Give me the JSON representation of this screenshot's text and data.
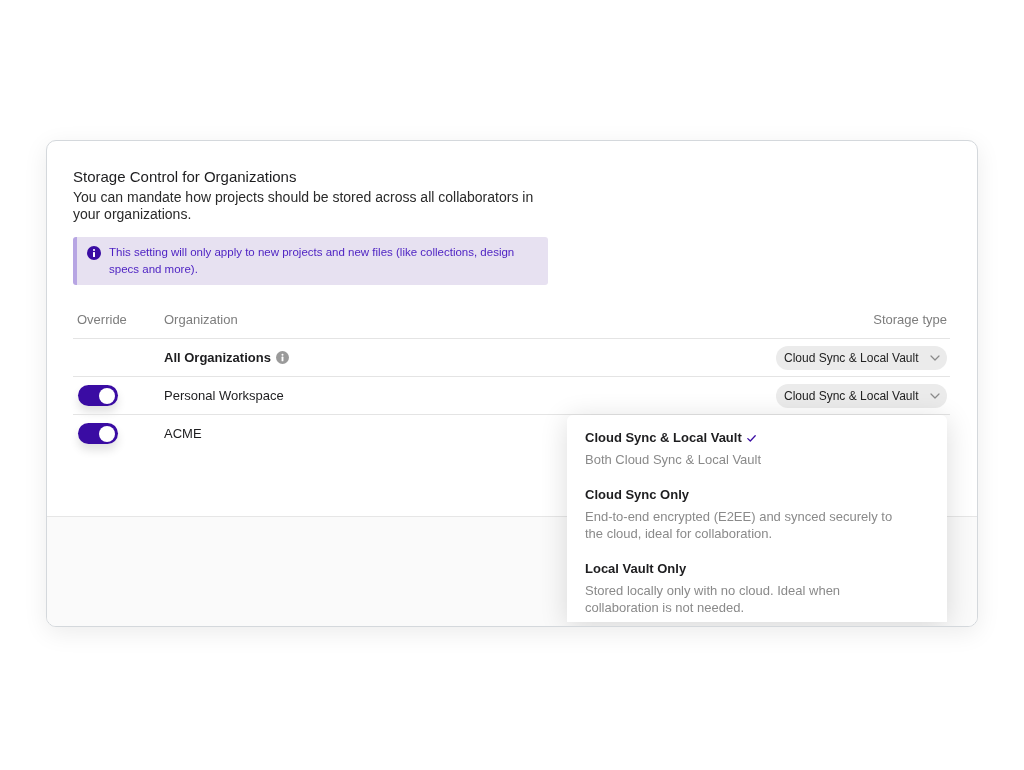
{
  "panel": {
    "title": "Storage Control for Organizations",
    "description": "You can mandate how projects should be stored across all collaborators in your organizations.",
    "notice": "This setting will only apply to new projects and new files (like collections, design specs and more)."
  },
  "table": {
    "columns": [
      "Override",
      "Organization",
      "Storage type"
    ],
    "rows": [
      {
        "kind": "summary",
        "organization": "All Organizations",
        "storage_type": "Cloud Sync & Local Vault"
      },
      {
        "kind": "org",
        "override": {
          "on": true
        },
        "organization": "Personal Workspace",
        "storage_type": "Cloud Sync & Local Vault"
      },
      {
        "kind": "org",
        "override": {
          "on": true
        },
        "organization": "ACME",
        "storage_menu": {
          "expanded": true,
          "options": [
            {
              "label": "Cloud Sync & Local Vault",
              "description": "Both Cloud Sync & Local Vault",
              "selected": true
            },
            {
              "label": "Cloud Sync Only",
              "description": "End-to-end encrypted (E2EE) and synced securely to the cloud, ideal for collaboration.",
              "selected": false
            },
            {
              "label": "Local Vault Only",
              "description": "Stored locally only with no cloud. Ideal when collaboration is not needed.",
              "selected": false
            }
          ]
        }
      }
    ]
  }
}
